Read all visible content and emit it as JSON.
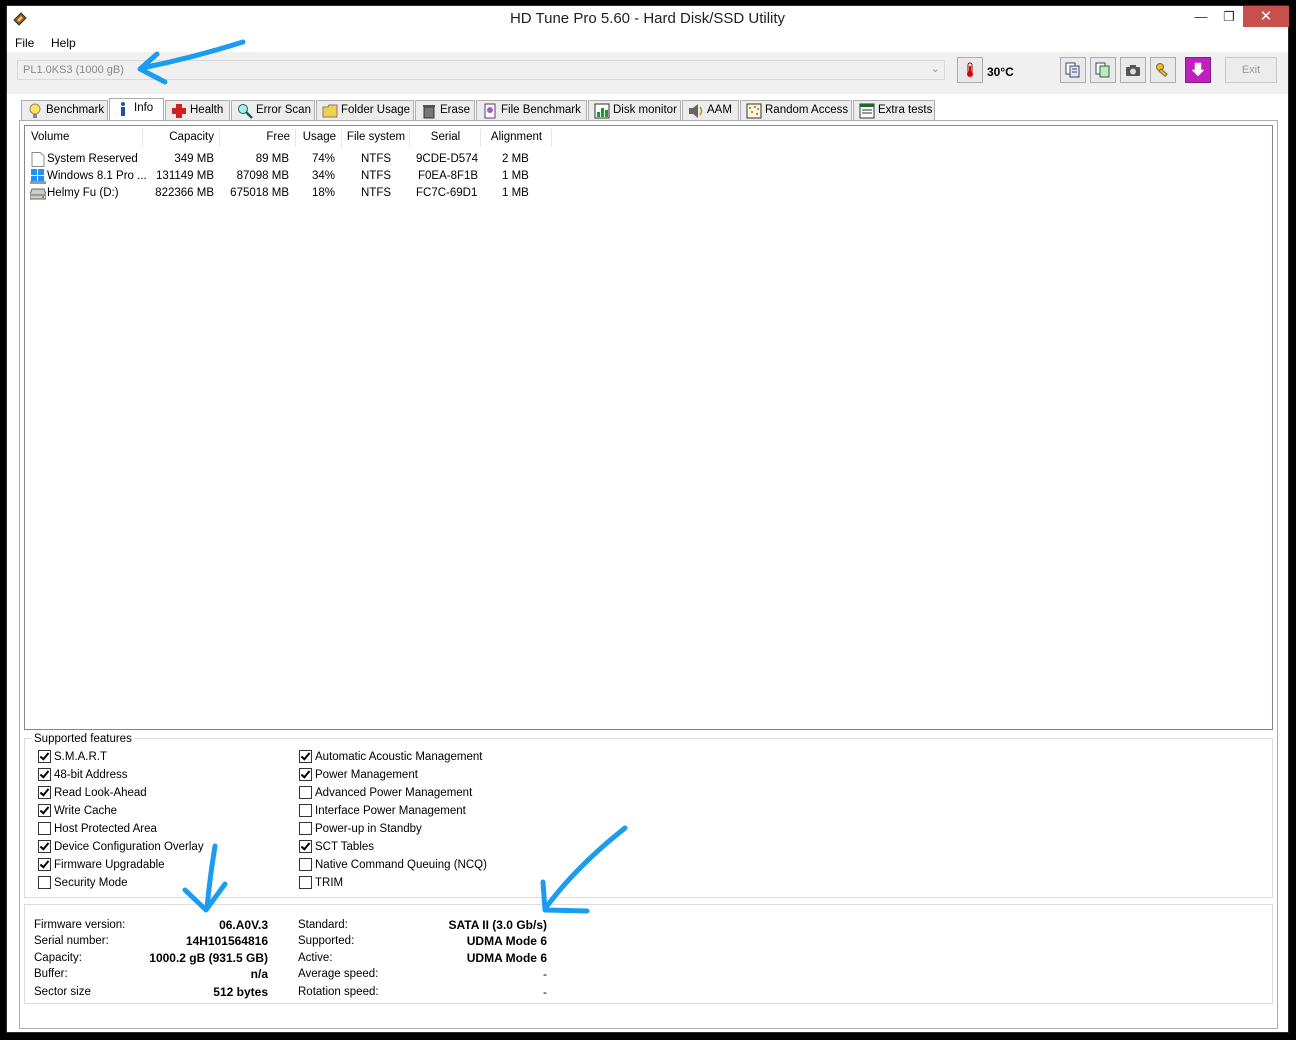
{
  "window": {
    "title": "HD Tune Pro 5.60 - Hard Disk/SSD Utility"
  },
  "menu": {
    "file": "File",
    "help": "Help"
  },
  "toolbar": {
    "drive": "PL1.0KS3 (1000 gB)",
    "temperature": "30°C",
    "exit_label": "Exit"
  },
  "tabs": [
    {
      "label": "Benchmark",
      "icon": "lightbulb-icon"
    },
    {
      "label": "Info",
      "icon": "info-icon"
    },
    {
      "label": "Health",
      "icon": "red-cross-icon"
    },
    {
      "label": "Error Scan",
      "icon": "magnifier-icon"
    },
    {
      "label": "Folder Usage",
      "icon": "folder-icon"
    },
    {
      "label": "Erase",
      "icon": "trash-icon"
    },
    {
      "label": "File Benchmark",
      "icon": "file-benchmark-icon"
    },
    {
      "label": "Disk monitor",
      "icon": "monitor-chart-icon"
    },
    {
      "label": "AAM",
      "icon": "speaker-icon"
    },
    {
      "label": "Random Access",
      "icon": "random-access-icon"
    },
    {
      "label": "Extra tests",
      "icon": "extra-tests-icon"
    }
  ],
  "volumes": {
    "headers": [
      "Volume",
      "Capacity",
      "Free",
      "Usage",
      "File system",
      "Serial",
      "Alignment"
    ],
    "rows": [
      {
        "volume": "System Reserved",
        "capacity": "349 MB",
        "free": "89 MB",
        "usage": "74%",
        "fs": "NTFS",
        "serial": "9CDE-D574",
        "alignment": "2 MB",
        "icon": "blank-drive-icon"
      },
      {
        "volume": "Windows 8.1 Pro ...",
        "capacity": "131149 MB",
        "free": "87098 MB",
        "usage": "34%",
        "fs": "NTFS",
        "serial": "F0EA-8F1B",
        "alignment": "1 MB",
        "icon": "windows-drive-icon"
      },
      {
        "volume": "Helmy Fu (D:)",
        "capacity": "822366 MB",
        "free": "675018 MB",
        "usage": "18%",
        "fs": "NTFS",
        "serial": "FC7C-69D1",
        "alignment": "1 MB",
        "icon": "hard-drive-icon"
      }
    ]
  },
  "features": {
    "legend": "Supported features",
    "left": [
      {
        "label": "S.M.A.R.T",
        "checked": true
      },
      {
        "label": "48-bit Address",
        "checked": true
      },
      {
        "label": "Read Look-Ahead",
        "checked": true
      },
      {
        "label": "Write Cache",
        "checked": true
      },
      {
        "label": "Host Protected Area",
        "checked": false
      },
      {
        "label": "Device Configuration Overlay",
        "checked": true
      },
      {
        "label": "Firmware Upgradable",
        "checked": true
      },
      {
        "label": "Security Mode",
        "checked": false
      }
    ],
    "right": [
      {
        "label": "Automatic Acoustic Management",
        "checked": true
      },
      {
        "label": "Power Management",
        "checked": true
      },
      {
        "label": "Advanced Power Management",
        "checked": false
      },
      {
        "label": "Interface Power Management",
        "checked": false
      },
      {
        "label": "Power-up in Standby",
        "checked": false
      },
      {
        "label": "SCT Tables",
        "checked": true
      },
      {
        "label": "Native Command Queuing (NCQ)",
        "checked": false
      },
      {
        "label": "TRIM",
        "checked": false
      }
    ]
  },
  "specs": {
    "left": [
      {
        "label": "Firmware version:",
        "value": "06.A0V.3"
      },
      {
        "label": "Serial number:",
        "value": "14H101564816"
      },
      {
        "label": "Capacity:",
        "value": "1000.2 gB (931.5 GB)"
      },
      {
        "label": "Buffer:",
        "value": "n/a"
      },
      {
        "label": "Sector size",
        "value": "512 bytes"
      }
    ],
    "right": [
      {
        "label": "Standard:",
        "value": "SATA II (3.0 Gb/s)"
      },
      {
        "label": "Supported:",
        "value": "UDMA Mode 6"
      },
      {
        "label": "Active:",
        "value": "UDMA Mode 6"
      },
      {
        "label": "Average speed:",
        "value": "-"
      },
      {
        "label": "Rotation speed:",
        "value": "-"
      }
    ]
  },
  "colors": {
    "close_button": "#c7504a",
    "annotation_arrow": "#1a9cf0"
  }
}
